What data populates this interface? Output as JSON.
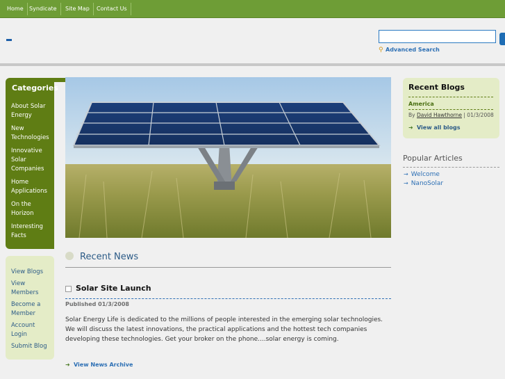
{
  "topnav": {
    "items": [
      {
        "label": "Home"
      },
      {
        "label": "Syndicate"
      },
      {
        "label": "Site Map"
      },
      {
        "label": "Contact Us"
      }
    ]
  },
  "header": {
    "logo_text": "-",
    "search": {
      "value": "",
      "placeholder": ""
    },
    "advanced_search": "Advanced Search"
  },
  "categories": {
    "title": "Categories",
    "items": [
      {
        "label": "About Solar Energy"
      },
      {
        "label": "New Technologies"
      },
      {
        "label": "Innovative Solar Companies"
      },
      {
        "label": "Home Applications"
      },
      {
        "label": "On the Horizon"
      },
      {
        "label": "Interesting Facts"
      }
    ]
  },
  "user_menu": {
    "items": [
      {
        "label": "View Blogs"
      },
      {
        "label": "View Members"
      },
      {
        "label": "Become a Member"
      },
      {
        "label": "Account Login"
      },
      {
        "label": "Submit Blog"
      }
    ]
  },
  "main": {
    "section_title": "Recent News",
    "post": {
      "title": "Solar Site Launch",
      "date": "Published 01/3/2008",
      "body": "Solar Energy Life is dedicated to the millions of people interested in the emerging solar technologies.  We will discuss the latest innovations, the practical applications and the hottest tech companies developing these technologies. Get your broker on the phone....solar energy is coming."
    },
    "archive_link": "View News Archive"
  },
  "recent_blogs": {
    "title": "Recent Blogs",
    "item": {
      "title": "America",
      "by": "By",
      "author": "David Hawthorne",
      "date": "| 01/3/2008"
    },
    "view_all": "View all blogs"
  },
  "popular_articles": {
    "title": "Popular Articles",
    "items": [
      {
        "label": "Welcome"
      },
      {
        "label": "NanoSolar"
      }
    ]
  },
  "colors": {
    "nav_green": "#6e9d36",
    "sidebar_green": "#5f7d14",
    "light_green": "#e4ecc7",
    "link_blue": "#2c6fb4"
  }
}
